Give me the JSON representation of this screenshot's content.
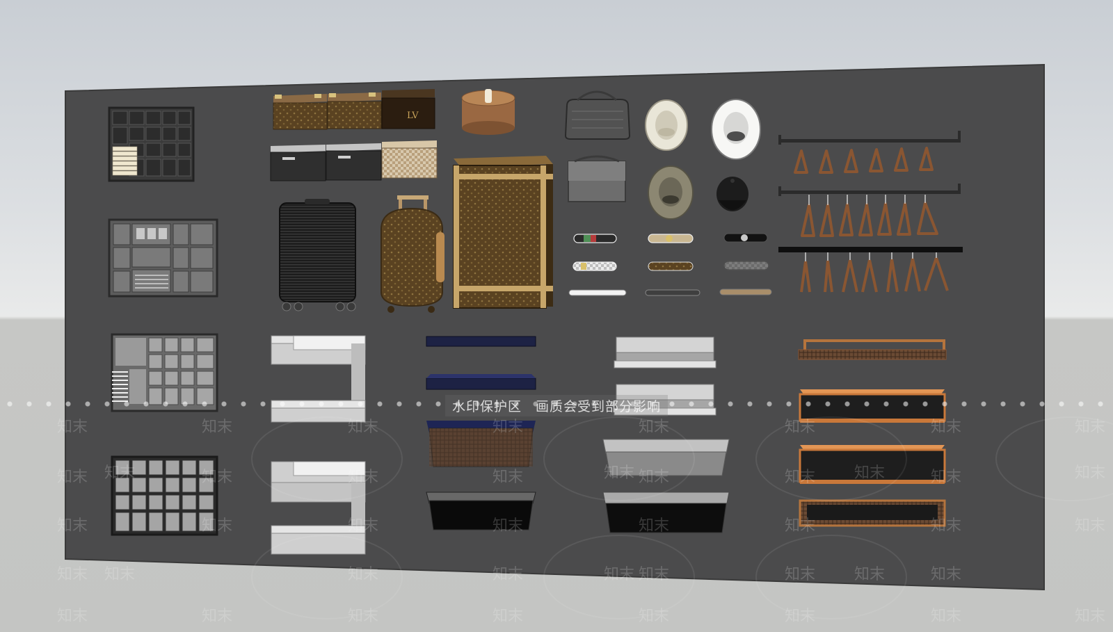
{
  "watermark": {
    "notice": "水印保护区　画质会受到部分影响",
    "logo_text": "知末"
  },
  "colors": {
    "sky_top": "#c9ced4",
    "ground": "#c5c6c4",
    "panel": "#4b4b4c",
    "panel_edge": "#3a3a3a",
    "wood_hanger": "#8a5632",
    "lv_brown": "#5b4322",
    "lv_gold": "#b89a5a",
    "drawer_orange": "#c9783a",
    "navy_shelf": "#1d2244"
  }
}
